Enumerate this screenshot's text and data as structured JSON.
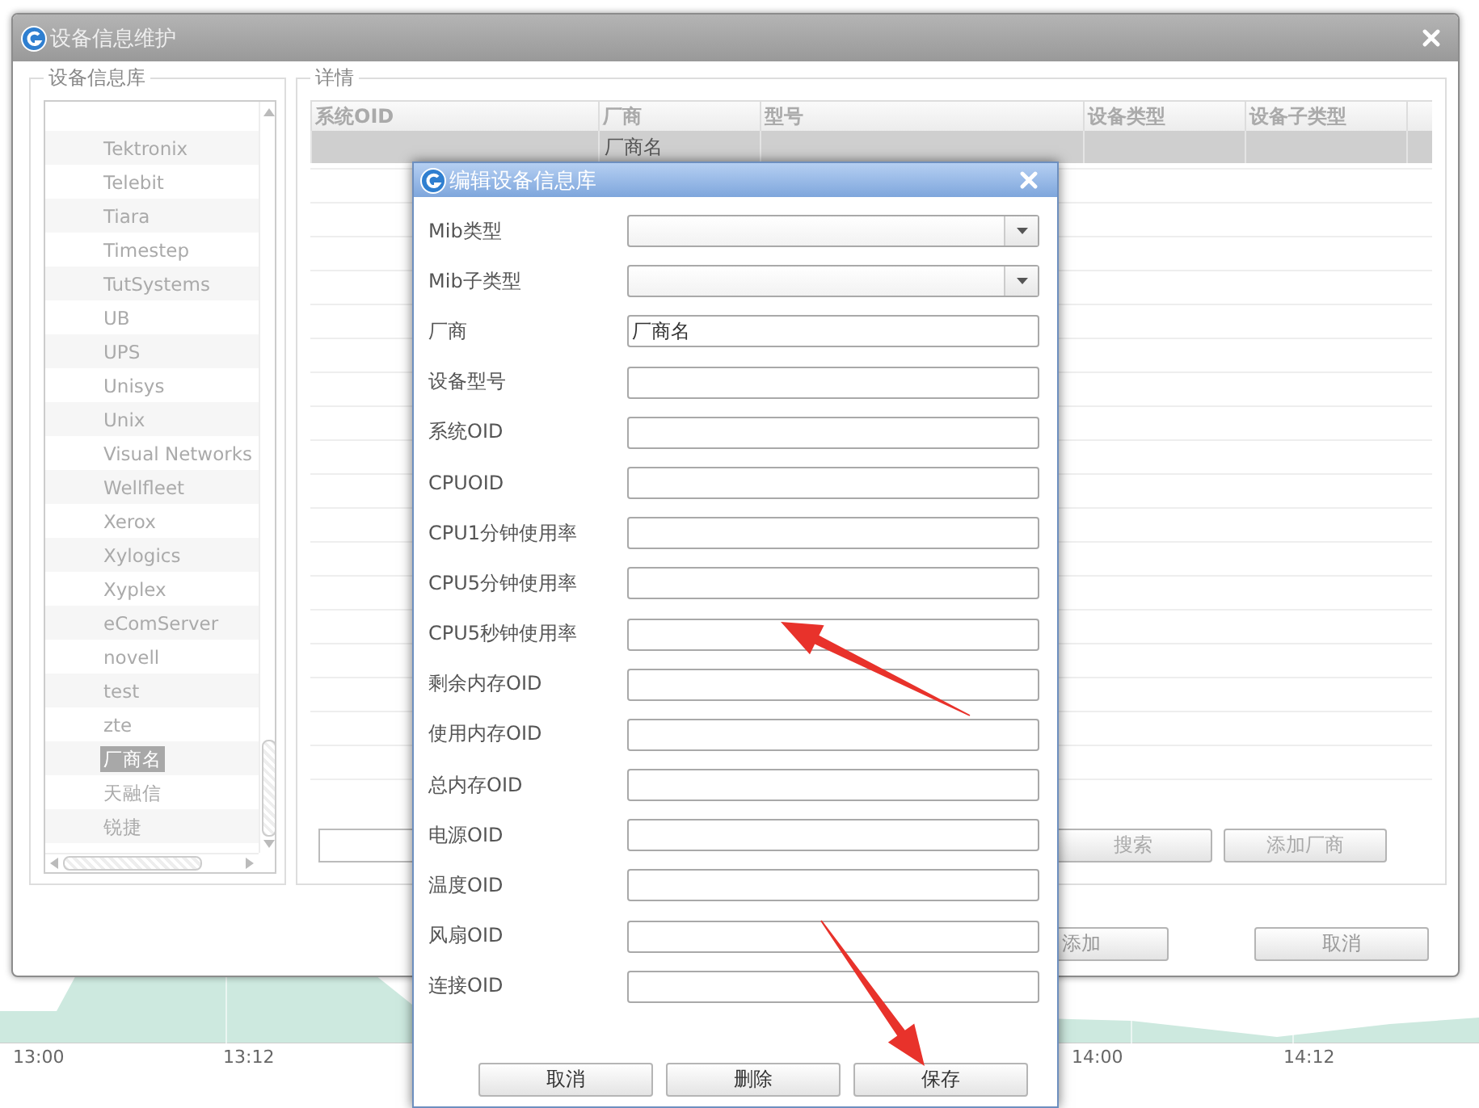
{
  "background_chart": {
    "time_labels": [
      "13:00",
      "13:12",
      "14:00",
      "14:12"
    ]
  },
  "main_window": {
    "title": "设备信息维护",
    "library": {
      "legend": "设备信息库",
      "items": [
        {
          "label": "Tektronix",
          "selected": false
        },
        {
          "label": "Telebit",
          "selected": false
        },
        {
          "label": "Tiara",
          "selected": false
        },
        {
          "label": "Timestep",
          "selected": false
        },
        {
          "label": "TutSystems",
          "selected": false
        },
        {
          "label": "UB",
          "selected": false
        },
        {
          "label": "UPS",
          "selected": false
        },
        {
          "label": "Unisys",
          "selected": false
        },
        {
          "label": "Unix",
          "selected": false
        },
        {
          "label": "Visual Networks",
          "selected": false
        },
        {
          "label": "Wellfleet",
          "selected": false
        },
        {
          "label": "Xerox",
          "selected": false
        },
        {
          "label": "Xylogics",
          "selected": false
        },
        {
          "label": "Xyplex",
          "selected": false
        },
        {
          "label": "eComServer",
          "selected": false
        },
        {
          "label": "novell",
          "selected": false
        },
        {
          "label": "test",
          "selected": false
        },
        {
          "label": "zte",
          "selected": false
        },
        {
          "label": "厂商名",
          "selected": true
        },
        {
          "label": "天融信",
          "selected": false
        },
        {
          "label": "锐捷",
          "selected": false
        }
      ]
    },
    "details": {
      "legend": "详情",
      "table": {
        "columns": [
          "系统OID",
          "厂商",
          "型号",
          "设备类型",
          "设备子类型"
        ],
        "rows": [
          {
            "selected": true,
            "cells": [
              null,
              "厂商名"
            ]
          }
        ]
      },
      "buttons": [
        "搜索",
        "添加厂商"
      ]
    },
    "footer_buttons": [
      "添加",
      "取消"
    ]
  },
  "dialog": {
    "title": "编辑设备信息库",
    "fields": [
      {
        "kind": "select",
        "label": "Mib类型"
      },
      {
        "kind": "select",
        "label": "Mib子类型"
      },
      {
        "kind": "text",
        "label": "厂商",
        "value": "厂商名"
      },
      {
        "kind": "text",
        "label": "设备型号"
      },
      {
        "kind": "text",
        "label": "系统OID"
      },
      {
        "kind": "text",
        "label": "CPUOID"
      },
      {
        "kind": "text",
        "label": "CPU1分钟使用率"
      },
      {
        "kind": "text",
        "label": "CPU5分钟使用率"
      },
      {
        "kind": "text",
        "label": "CPU5秒钟使用率"
      },
      {
        "kind": "text",
        "label": "剩余内存OID"
      },
      {
        "kind": "text",
        "label": "使用内存OID"
      },
      {
        "kind": "text",
        "label": "总内存OID"
      },
      {
        "kind": "text",
        "label": "电源OID"
      },
      {
        "kind": "text",
        "label": "温度OID"
      },
      {
        "kind": "text",
        "label": "风扇OID"
      },
      {
        "kind": "text",
        "label": "连接OID"
      }
    ],
    "buttons": [
      "取消",
      "删除",
      "保存"
    ]
  }
}
